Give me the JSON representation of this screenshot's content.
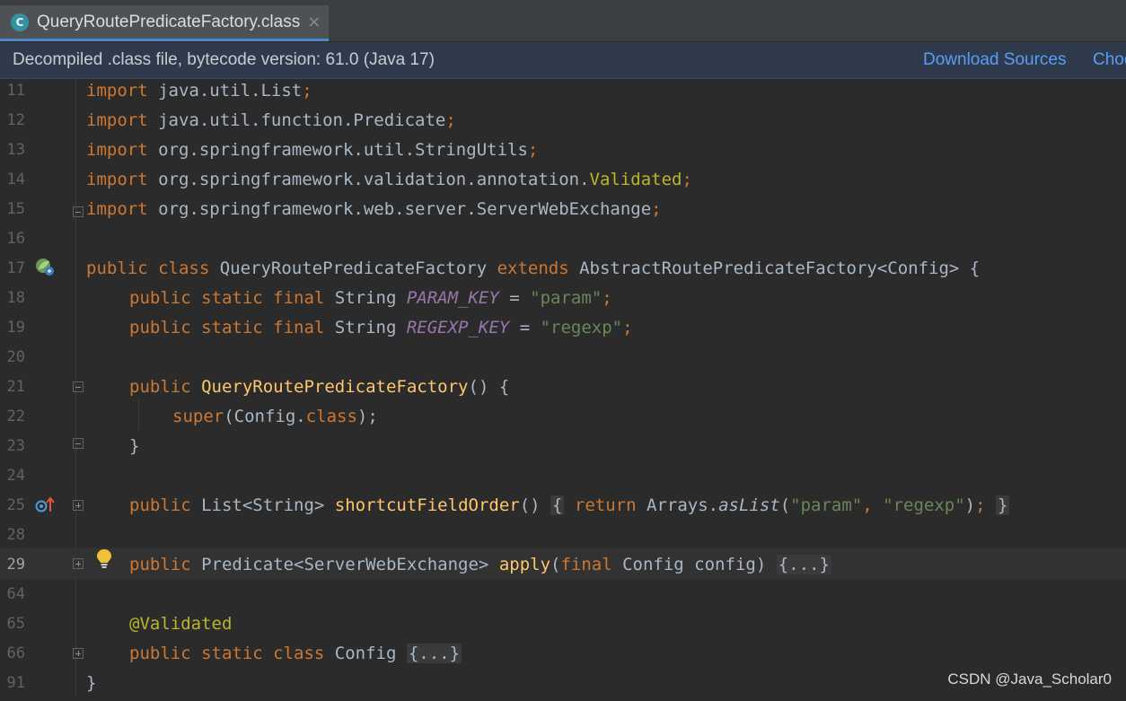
{
  "tab": {
    "icon_letter": "C",
    "label": "QueryRoutePredicateFactory.class",
    "close": "×"
  },
  "banner": {
    "text": "Decompiled .class file, bytecode version: 61.0 (Java 17)",
    "download_sources": "Download Sources",
    "choose_sources": "Choo"
  },
  "gutter": {
    "line_numbers": [
      "11",
      "12",
      "13",
      "14",
      "15",
      "16",
      "17",
      "18",
      "19",
      "20",
      "21",
      "22",
      "23",
      "24",
      "25",
      "28",
      "29",
      "64",
      "65",
      "66",
      "91"
    ]
  },
  "code": {
    "l11": {
      "kw": "import",
      "rest": " java.util.List",
      "semi": ";"
    },
    "l12": {
      "kw": "import",
      "rest": " java.util.function.Predicate",
      "semi": ";"
    },
    "l13": {
      "kw": "import",
      "rest": " org.springframework.util.StringUtils",
      "semi": ";"
    },
    "l14": {
      "kw": "import",
      "rest": " org.springframework.validation.annotation.",
      "ann": "Validated",
      "semi": ";"
    },
    "l15": {
      "kw": "import",
      "rest": " org.springframework.web.server.ServerWebExchange",
      "semi": ";"
    },
    "l17": {
      "kw1": "public class",
      "name": " QueryRoutePredicateFactory ",
      "kw2": "extends",
      "rest": " AbstractRoutePredicateFactory<Config> {"
    },
    "l18": {
      "kw": "public static final",
      "type": " String ",
      "const": "PARAM_KEY",
      "eq": " = ",
      "str": "\"param\"",
      "semi": ";"
    },
    "l19": {
      "kw": "public static final",
      "type": " String ",
      "const": "REGEXP_KEY",
      "eq": " = ",
      "str": "\"regexp\"",
      "semi": ";"
    },
    "l21": {
      "kw": "public",
      "fn": " QueryRoutePredicateFactory",
      "rest": "() {"
    },
    "l22": {
      "kw": "super",
      "p1": "(Config.",
      "kw2": "class",
      "p2": ");"
    },
    "l23": {
      "rest": "}"
    },
    "l25": {
      "kw": "public",
      "type": " List<String> ",
      "fn": "shortcutFieldOrder",
      "p": "() ",
      "fold_open": "{",
      "kw2": " return",
      "rest": " Arrays.",
      "call": "asList",
      "a1": "(",
      "s1": "\"param\"",
      "comma": ", ",
      "s2": "\"regexp\"",
      "a2": ")",
      "semi": ";",
      "fold_close": "}"
    },
    "l29": {
      "kw": "public",
      "type": " Predicate<ServerWebExchange> ",
      "fn": "apply",
      "p1": "(",
      "kw2": "final",
      "p2": " Config config) ",
      "fold": "{...}"
    },
    "l65": {
      "ann": "@Validated"
    },
    "l66": {
      "kw": "public static class",
      "type": " Config ",
      "fold": "{...}"
    },
    "l91": {
      "rest": "}"
    }
  },
  "watermark": "CSDN @Java_Scholar0",
  "colors": {
    "keyword": "#cc7832",
    "annotation": "#bbb529",
    "function": "#ffc66d",
    "string": "#6a8759",
    "constant": "#9876aa",
    "text": "#a9b7c6",
    "link": "#589df6",
    "background": "#2b2b2b"
  }
}
